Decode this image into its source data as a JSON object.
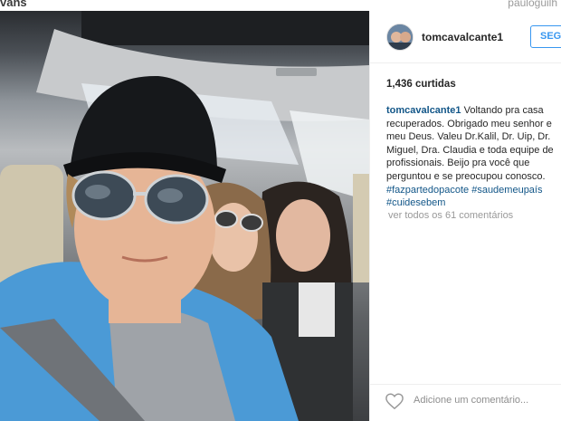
{
  "watermark": {
    "left_text": "vans",
    "right_text": "pauloguilh"
  },
  "post": {
    "username": "tomcavalcante1",
    "follow_label": "SEGU",
    "likes": "1,436 curtidas",
    "caption_user": "tomcavalcante1",
    "caption_text": "Voltando pra casa recuperados. Obrigado meu senhor e meu Deus. Valeu Dr.Kalil, Dr. Uip, Dr. Miguel, Dra. Claudia e toda equipe de profissionais. Beijo pra você que perguntou e se preocupou conosco.",
    "hashtags": [
      "#fazpartedopacote",
      "#saudemeupaís",
      "#cuidesebem"
    ],
    "view_all_comments": "ver todos os 61 comentários",
    "add_comment_placeholder": "Adicione um comentário..."
  },
  "icons": {
    "like": "heart-outline-icon"
  },
  "colors": {
    "link": "#125688",
    "follow": "#3897f0",
    "muted": "#999999"
  }
}
